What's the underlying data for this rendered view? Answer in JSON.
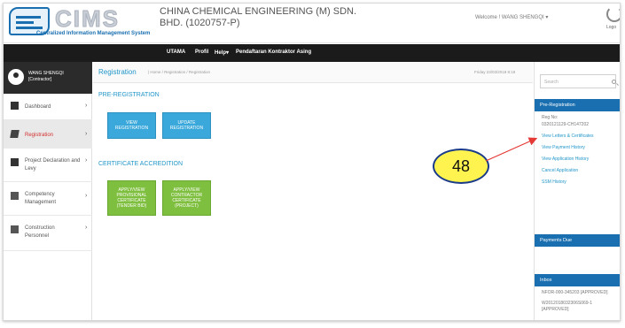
{
  "header": {
    "logo_text": "CIMS",
    "logo_subtitle": "Centralized Information Management System",
    "company": "CHINA CHEMICAL ENGINEERING (M) SDN. BHD. (1020757-P)",
    "welcome": "Welcome ! WANG SHENGQI ▾",
    "logout_label": "Logo"
  },
  "navbar": {
    "items": [
      "UTAMA",
      "Profil",
      "Help▾",
      "Pendaftaran Kontraktor Asing"
    ]
  },
  "sidebar": {
    "user_name": "WANG SHENGQI",
    "user_role": "[Contractor]",
    "items": [
      {
        "label": "Dashboard",
        "icon": "dashboard-icon"
      },
      {
        "label": "Registration",
        "icon": "registration-icon"
      },
      {
        "label": "Project Declaration and Levy",
        "icon": "project-icon"
      },
      {
        "label": "Competency Management",
        "icon": "competency-icon"
      },
      {
        "label": "Construction Personnel",
        "icon": "personnel-icon"
      }
    ]
  },
  "main": {
    "title": "Registration",
    "breadcrumb": "| Home / Registration / Registration",
    "date": "Friday 23/03/2018 8:18",
    "pre_registration": "PRE-REGISTRATION",
    "view_registration": "VIEW REGISTRATION",
    "update_registration": "UPDATE REGISTRATION",
    "cert_accreditation": "CERTIFICATE ACCREDITION",
    "apply_provisional": "APPLY/VIEW PROVISIONAL CERTIFICATE (TENDER BID)",
    "apply_contractor": "APPLY/VIEW CONTRACTOR CERTIFICATE (PROJECT)"
  },
  "right_panel": {
    "search_placeholder": "Search",
    "pre_registration_head": "Pre-Registration",
    "reg_no_label": "Reg No:",
    "reg_no_value": "0320121129-CH147202",
    "links": [
      "View Letters & Certificates",
      "View Payment History",
      "View Application History",
      "Cancel Application",
      "SSM History"
    ],
    "payments_due_head": "Payments Due",
    "inbox_head": "Inbox",
    "inbox_items": [
      "NFOR-000-345203 [APPROVED]",
      "W2012018032306S069-1 [APPROVED]"
    ]
  },
  "callout": {
    "number": "48",
    "fill_color": "#fff44f",
    "arrow_color": "#e53935"
  }
}
